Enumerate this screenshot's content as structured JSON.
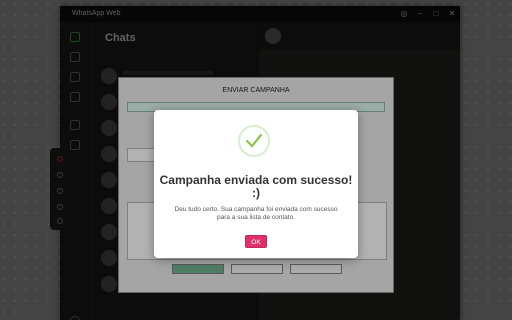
{
  "window": {
    "title": "WhatsApp Web"
  },
  "chatlist": {
    "header": "Chats"
  },
  "campaign": {
    "title": "ENVIAR CAMPANHA",
    "buttons": [
      "",
      "",
      ""
    ]
  },
  "modal": {
    "title": "Campanha enviada com sucesso! :)",
    "message": "Deu tudo certo. Sua campanha foi enviada com sucesso para a sua lista de contato.",
    "ok_label": "OK"
  },
  "colors": {
    "ok": "#e0306a",
    "check": "#8bc34a"
  }
}
